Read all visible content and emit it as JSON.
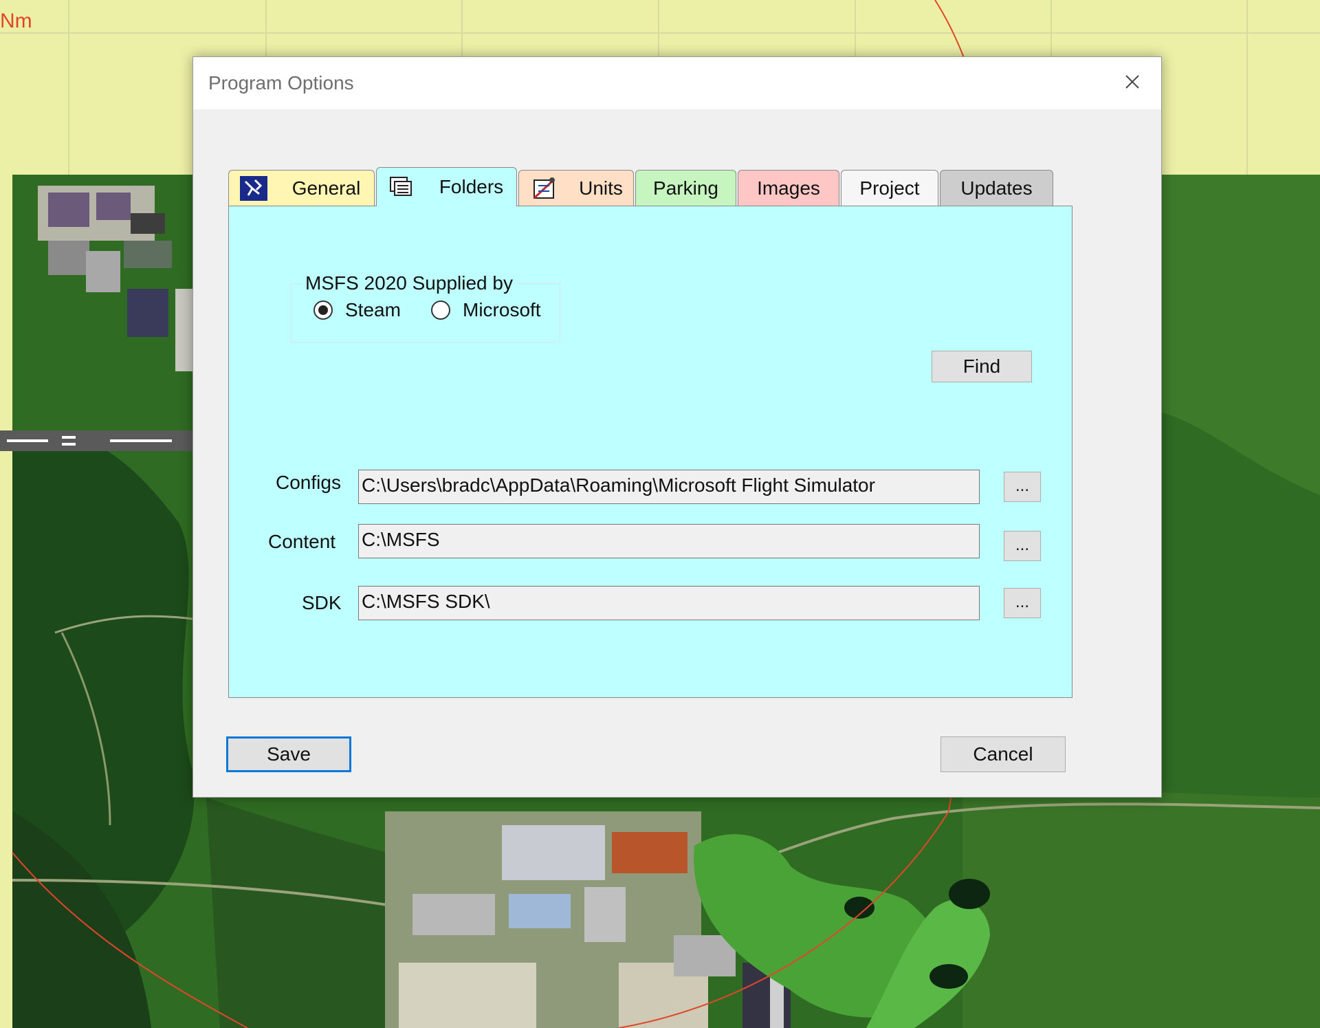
{
  "background": {
    "scale_label": "Nm"
  },
  "dialog": {
    "title": "Program Options",
    "close_icon": "close-icon",
    "tabs": [
      {
        "label": "General",
        "icon": "general-settings-icon",
        "color": "#fff6b4"
      },
      {
        "label": "Folders",
        "icon": "folders-icon",
        "color": "#beffff",
        "active": true
      },
      {
        "label": "Units",
        "icon": "units-icon",
        "color": "#ffe0c6"
      },
      {
        "label": "Parking",
        "color": "#c6f5c0"
      },
      {
        "label": "Images",
        "color": "#ffc6c6"
      },
      {
        "label": "Project",
        "color": "#f6f6f6"
      },
      {
        "label": "Updates",
        "color": "#cdcdcd"
      }
    ],
    "folders": {
      "supplier_group": {
        "legend": "MSFS 2020 Supplied by",
        "options": [
          {
            "label": "Steam",
            "selected": true
          },
          {
            "label": "Microsoft",
            "selected": false
          }
        ]
      },
      "find_label": "Find",
      "fields": [
        {
          "label": "Configs",
          "value": "C:\\Users\\bradc\\AppData\\Roaming\\Microsoft Flight Simulator",
          "browse_label": "..."
        },
        {
          "label": "Content",
          "value": "C:\\MSFS",
          "browse_label": "..."
        },
        {
          "label": "SDK",
          "value": "C:\\MSFS SDK\\",
          "browse_label": "..."
        }
      ]
    },
    "save_label": "Save",
    "cancel_label": "Cancel"
  },
  "colors": {
    "panel_background": "#beffff",
    "map_grid_background": "#ecf0a6",
    "save_focus_border": "#0a76d6"
  }
}
